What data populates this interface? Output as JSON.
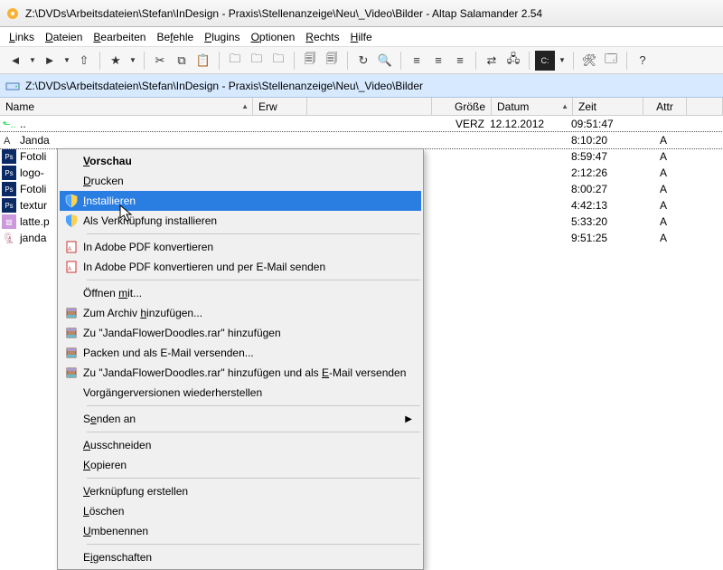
{
  "window": {
    "title": "Z:\\DVDs\\Arbeitsdateien\\Stefan\\InDesign - Praxis\\Stellenanzeige\\Neu\\_Video\\Bilder - Altap Salamander 2.54"
  },
  "menu": {
    "items": [
      "Links",
      "Dateien",
      "Bearbeiten",
      "Befehle",
      "Plugins",
      "Optionen",
      "Rechts",
      "Hilfe"
    ]
  },
  "pathbar": {
    "path": "Z:\\DVDs\\Arbeitsdateien\\Stefan\\InDesign - Praxis\\Stellenanzeige\\Neu\\_Video\\Bilder"
  },
  "columns": {
    "name": "Name",
    "ext": "Erw",
    "size": "Größe",
    "date": "Datum",
    "time": "Zeit",
    "attr": "Attr"
  },
  "rows": [
    {
      "icon": "up",
      "name": "..",
      "size": "VERZ",
      "date": "12.12.2012",
      "time": "09:51:47",
      "attr": ""
    },
    {
      "icon": "font",
      "name": "Janda",
      "size": "",
      "date": "",
      "time": "8:10:20",
      "attr": "A",
      "selected": true
    },
    {
      "icon": "ps",
      "name": "Fotoli",
      "size": "",
      "date": "",
      "time": "8:59:47",
      "attr": "A"
    },
    {
      "icon": "ps",
      "name": "logo-",
      "size": "",
      "date": "",
      "time": "2:12:26",
      "attr": "A"
    },
    {
      "icon": "ps",
      "name": "Fotoli",
      "size": "",
      "date": "",
      "time": "8:00:27",
      "attr": "A"
    },
    {
      "icon": "ps",
      "name": "textur",
      "size": "",
      "date": "",
      "time": "4:42:13",
      "attr": "A"
    },
    {
      "icon": "jpg",
      "name": "latte.p",
      "size": "",
      "date": "",
      "time": "5:33:20",
      "attr": "A"
    },
    {
      "icon": "zip",
      "name": "janda",
      "size": "",
      "date": "",
      "time": "9:51:25",
      "attr": "A"
    }
  ],
  "ctx": {
    "vorschau": "Vorschau",
    "drucken": "Drucken",
    "installieren": "Installieren",
    "verknupfung": "Als Verknüpfung installieren",
    "pdf1": "In Adobe PDF konvertieren",
    "pdf2": "In Adobe PDF konvertieren und per E-Mail senden",
    "offnen": "Öffnen mit...",
    "archiv1": "Zum Archiv hinzufügen...",
    "archiv2": "Zu \"JandaFlowerDoodles.rar\" hinzufügen",
    "archiv3": "Packen und als E-Mail versenden...",
    "archiv4": "Zu \"JandaFlowerDoodles.rar\" hinzufügen und als E-Mail versenden",
    "vorganger": "Vorgängerversionen wiederherstellen",
    "senden": "Senden an",
    "ausschneiden": "Ausschneiden",
    "kopieren": "Kopieren",
    "verkn": "Verknüpfung erstellen",
    "loschen": "Löschen",
    "umbenennen": "Umbenennen",
    "eigenschaften": "Eigenschaften"
  }
}
